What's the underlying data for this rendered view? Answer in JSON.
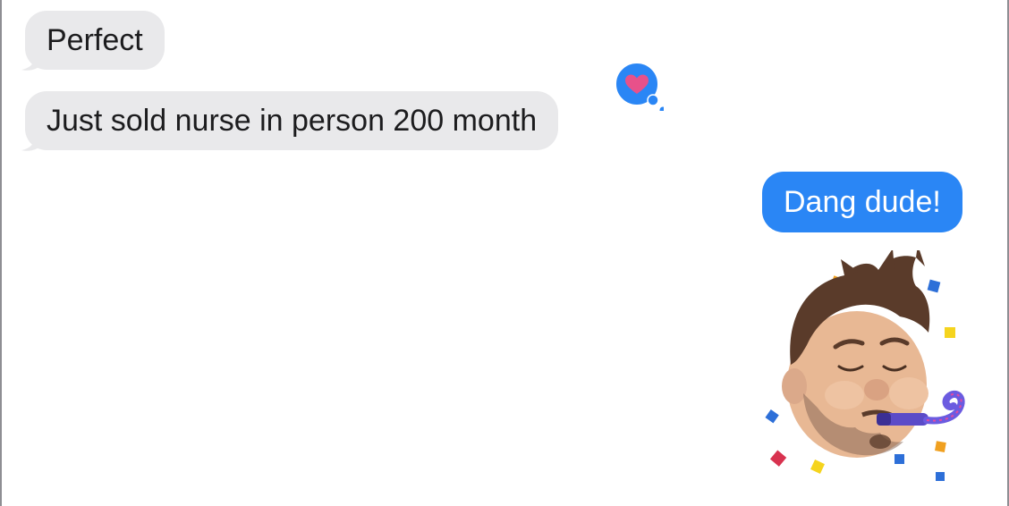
{
  "conversation": {
    "messages": [
      {
        "direction": "incoming",
        "text": "Perfect"
      },
      {
        "direction": "incoming",
        "text": "Just sold nurse in person 200 month",
        "reaction": "heart-icon"
      },
      {
        "direction": "outgoing",
        "text": "Dang dude!"
      },
      {
        "direction": "outgoing",
        "sticker": "memoji-party-blower-sticker"
      }
    ]
  },
  "colors": {
    "incoming_bubble": "#e9e9eb",
    "outgoing_bubble": "#2a86f5",
    "reaction_badge": "#2a86f5",
    "heart": "#e8518a"
  }
}
